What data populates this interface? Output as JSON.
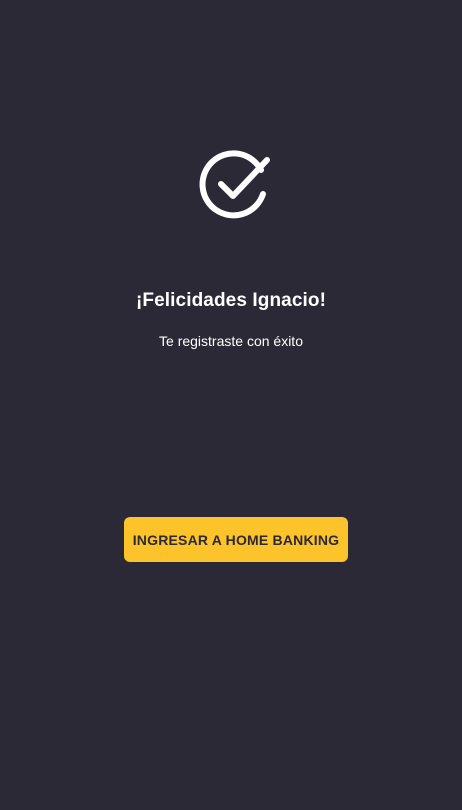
{
  "success": {
    "icon": "check-circle-icon",
    "title": "¡Felicidades Ignacio!",
    "subtitle": "Te registraste con éxito"
  },
  "actions": {
    "primary_label": "INGRESAR A HOME BANKING"
  },
  "colors": {
    "background": "#2c2937",
    "accent": "#fcc32a",
    "text": "#ffffff"
  }
}
